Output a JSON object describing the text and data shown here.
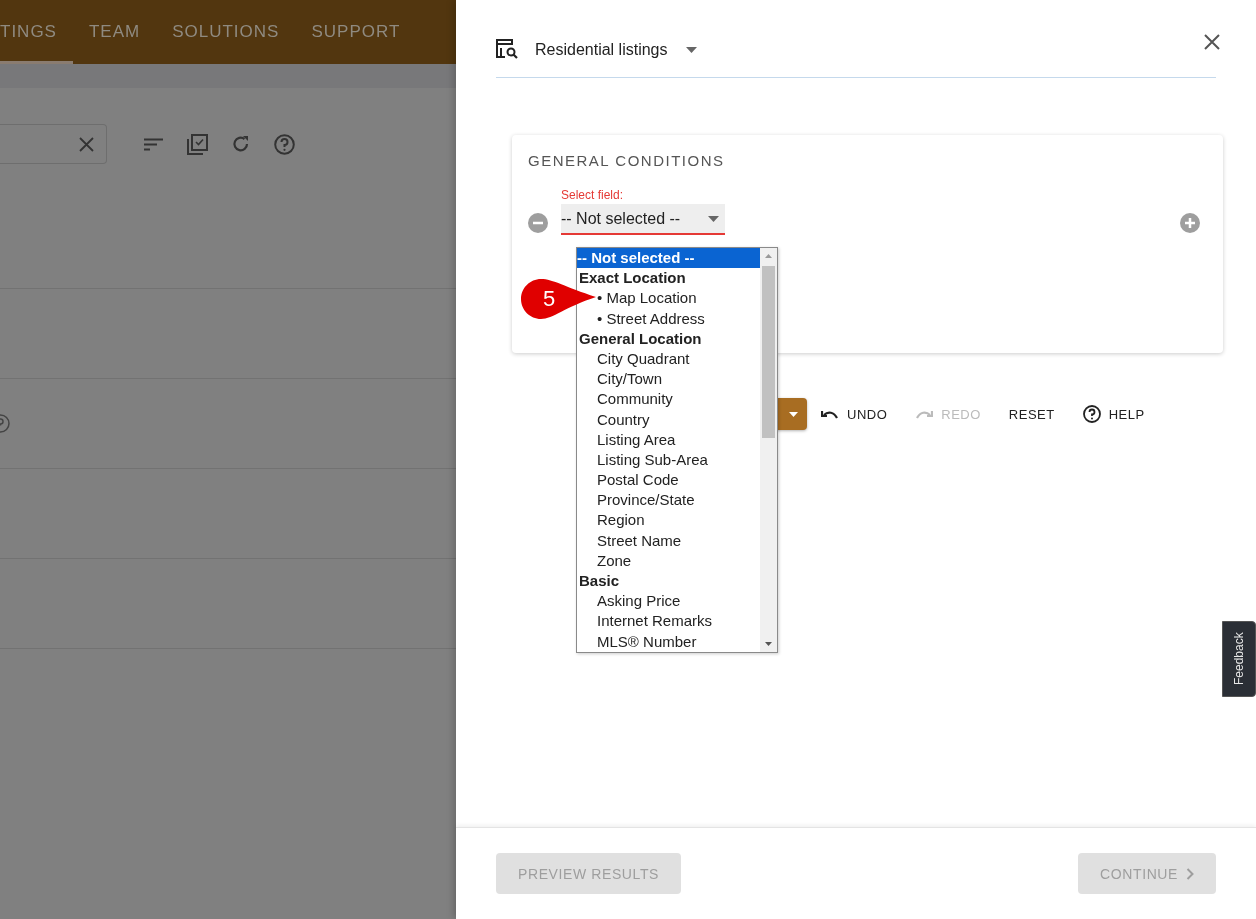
{
  "background_page": {
    "nav_tabs": [
      {
        "label": "TINGS",
        "selected": true
      },
      {
        "label": "TEAM",
        "selected": false
      },
      {
        "label": "SOLUTIONS",
        "selected": false
      },
      {
        "label": "SUPPORT",
        "selected": false
      }
    ]
  },
  "panel": {
    "title": "Residential listings",
    "card": {
      "heading": "GENERAL CONDITIONS",
      "field_label": "Select field:",
      "field_value": "-- Not selected --"
    },
    "dropdown": [
      {
        "label": "-- Not selected --",
        "kind": "option",
        "selected": true
      },
      {
        "label": "Exact Location",
        "kind": "group",
        "selected": false
      },
      {
        "label": "• Map Location",
        "kind": "option",
        "selected": false
      },
      {
        "label": "• Street Address",
        "kind": "option",
        "selected": false
      },
      {
        "label": "General Location",
        "kind": "group",
        "selected": false
      },
      {
        "label": "City Quadrant",
        "kind": "option",
        "selected": false
      },
      {
        "label": "City/Town",
        "kind": "option",
        "selected": false
      },
      {
        "label": "Community",
        "kind": "option",
        "selected": false
      },
      {
        "label": "Country",
        "kind": "option",
        "selected": false
      },
      {
        "label": "Listing Area",
        "kind": "option",
        "selected": false
      },
      {
        "label": "Listing Sub-Area",
        "kind": "option",
        "selected": false
      },
      {
        "label": "Postal Code",
        "kind": "option",
        "selected": false
      },
      {
        "label": "Province/State",
        "kind": "option",
        "selected": false
      },
      {
        "label": "Region",
        "kind": "option",
        "selected": false
      },
      {
        "label": "Street Name",
        "kind": "option",
        "selected": false
      },
      {
        "label": "Zone",
        "kind": "option",
        "selected": false
      },
      {
        "label": "Basic",
        "kind": "group",
        "selected": false
      },
      {
        "label": "Asking Price",
        "kind": "option",
        "selected": false
      },
      {
        "label": "Internet Remarks",
        "kind": "option",
        "selected": false
      },
      {
        "label": "MLS® Number",
        "kind": "option",
        "selected": false
      }
    ],
    "callout": "5",
    "toolbar": [
      {
        "label": "UNDO",
        "kind": "undo",
        "disabled": false
      },
      {
        "label": "REDO",
        "kind": "redo",
        "disabled": true
      },
      {
        "label": "RESET",
        "kind": "plain",
        "disabled": false
      },
      {
        "label": "HELP",
        "kind": "help",
        "disabled": false
      }
    ],
    "footer": [
      {
        "label": "PREVIEW RESULTS",
        "kind": "plain",
        "disabled": true
      },
      {
        "label": "CONTINUE",
        "kind": "next",
        "disabled": true
      }
    ]
  },
  "feedback_tab": "Feedback"
}
